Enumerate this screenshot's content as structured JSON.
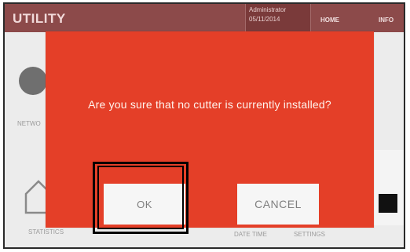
{
  "header": {
    "title": "UTILITY",
    "user_name": "Administrator",
    "date": "05/11/2014",
    "nav_home": "HOME",
    "nav_info": "INFO"
  },
  "background": {
    "network_label": "NETWO",
    "statistics_label": "STATISTICS",
    "date_time_label": "DATE TIME",
    "settings_label": "SETTINGS"
  },
  "dialog": {
    "message": "Are you sure that no cutter is currently installed?",
    "ok_label": "OK",
    "cancel_label": "CANCEL"
  },
  "colors": {
    "dialog_background": "#e43f28",
    "header_background": "#8c4a4a",
    "button_background": "#f6f6f6"
  }
}
